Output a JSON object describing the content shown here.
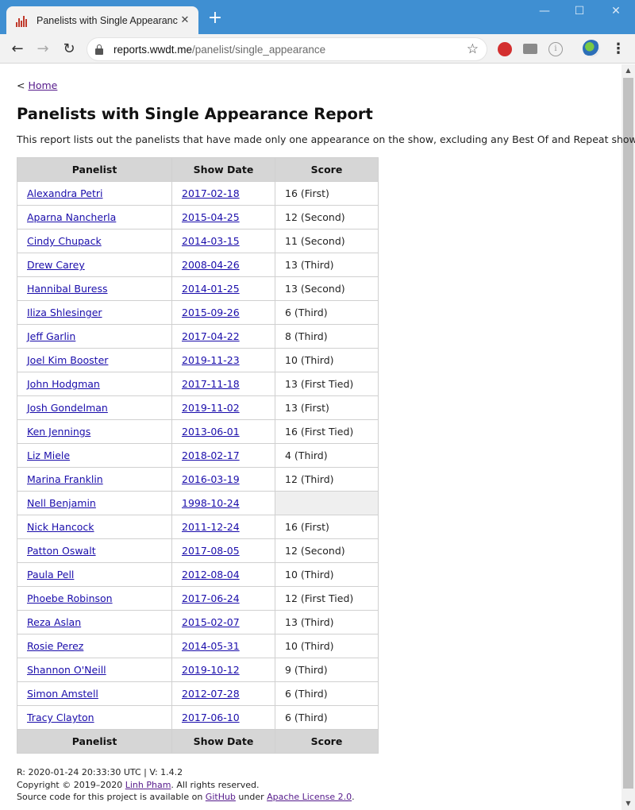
{
  "browser": {
    "tab_title": "Panelists with Single Appearance",
    "new_tab_label": "+",
    "url_host": "reports.wwdt.me",
    "url_path": "/panelist/single_appearance",
    "window_controls": {
      "minimize": "—",
      "maximize": "☐",
      "close": "✕"
    }
  },
  "page": {
    "breadcrumb_prefix": "< ",
    "breadcrumb_link": "Home",
    "title": "Panelists with Single Appearance Report",
    "description": "This report lists out the panelists that have made only one appearance on the show, excluding any Best Of and Repeat shows."
  },
  "table": {
    "headers": [
      "Panelist",
      "Show Date",
      "Score"
    ],
    "rows": [
      {
        "panelist": "Alexandra Petri",
        "date": "2017-02-18",
        "score": "16 (First)"
      },
      {
        "panelist": "Aparna Nancherla",
        "date": "2015-04-25",
        "score": "12 (Second)"
      },
      {
        "panelist": "Cindy Chupack",
        "date": "2014-03-15",
        "score": "11 (Second)"
      },
      {
        "panelist": "Drew Carey",
        "date": "2008-04-26",
        "score": "13 (Third)"
      },
      {
        "panelist": "Hannibal Buress",
        "date": "2014-01-25",
        "score": "13 (Second)"
      },
      {
        "panelist": "Iliza Shlesinger",
        "date": "2015-09-26",
        "score": "6 (Third)"
      },
      {
        "panelist": "Jeff Garlin",
        "date": "2017-04-22",
        "score": "8 (Third)"
      },
      {
        "panelist": "Joel Kim Booster",
        "date": "2019-11-23",
        "score": "10 (Third)"
      },
      {
        "panelist": "John Hodgman",
        "date": "2017-11-18",
        "score": "13 (First Tied)"
      },
      {
        "panelist": "Josh Gondelman",
        "date": "2019-11-02",
        "score": "13 (First)"
      },
      {
        "panelist": "Ken Jennings",
        "date": "2013-06-01",
        "score": "16 (First Tied)"
      },
      {
        "panelist": "Liz Miele",
        "date": "2018-02-17",
        "score": "4 (Third)"
      },
      {
        "panelist": "Marina Franklin",
        "date": "2016-03-19",
        "score": "12 (Third)"
      },
      {
        "panelist": "Nell Benjamin",
        "date": "1998-10-24",
        "score": ""
      },
      {
        "panelist": "Nick Hancock",
        "date": "2011-12-24",
        "score": "16 (First)"
      },
      {
        "panelist": "Patton Oswalt",
        "date": "2017-08-05",
        "score": "12 (Second)"
      },
      {
        "panelist": "Paula Pell",
        "date": "2012-08-04",
        "score": "10 (Third)"
      },
      {
        "panelist": "Phoebe Robinson",
        "date": "2017-06-24",
        "score": "12 (First Tied)"
      },
      {
        "panelist": "Reza Aslan",
        "date": "2015-02-07",
        "score": "13 (Third)"
      },
      {
        "panelist": "Rosie Perez",
        "date": "2014-05-31",
        "score": "10 (Third)"
      },
      {
        "panelist": "Shannon O'Neill",
        "date": "2019-10-12",
        "score": "9 (Third)"
      },
      {
        "panelist": "Simon Amstell",
        "date": "2012-07-28",
        "score": "6 (Third)"
      },
      {
        "panelist": "Tracy Clayton",
        "date": "2017-06-10",
        "score": "6 (Third)"
      }
    ]
  },
  "footer": {
    "line1": "R: 2020-01-24 20:33:30 UTC | V: 1.4.2",
    "copyright_prefix": "Copyright © 2019–2020 ",
    "author_link": "Linh Pham",
    "copyright_suffix": ". All rights reserved.",
    "source_prefix": "Source code for this project is available on ",
    "github_link": "GitHub",
    "source_middle": " under ",
    "license_link": "Apache License 2.0",
    "source_suffix": "."
  },
  "colors": {
    "titlebar": "#3f8fd2",
    "link": "#1a0dab",
    "visited_link": "#551a8b",
    "table_header": "#d6d6d6"
  }
}
